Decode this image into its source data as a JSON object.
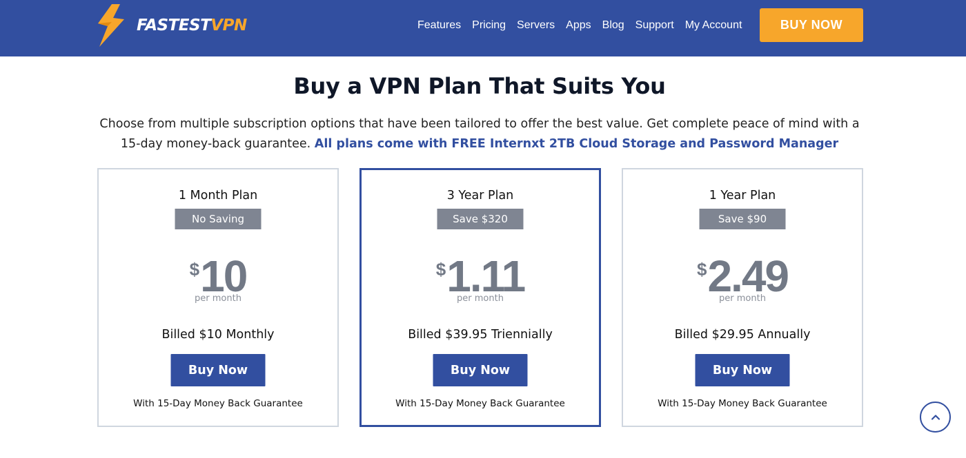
{
  "header": {
    "logo": {
      "part1": "FASTEST",
      "part2": "VPN"
    },
    "nav": [
      "Features",
      "Pricing",
      "Servers",
      "Apps",
      "Blog",
      "Support",
      "My Account"
    ],
    "cta": "BUY NOW"
  },
  "main": {
    "title": "Buy a VPN Plan That Suits You",
    "subtitle": "Choose from multiple subscription options that have been tailored to offer the best value. Get complete peace of mind with a 15-day money-back guarantee.",
    "subtitle_highlight": "All plans come with FREE Internxt 2TB Cloud Storage and Password Manager"
  },
  "plans": [
    {
      "name": "1 Month Plan",
      "badge": "No Saving",
      "currency": "$",
      "price": "10",
      "per": "per month",
      "billed": "Billed $10 Monthly",
      "button": "Buy Now",
      "guarantee": "With 15-Day Money Back Guarantee"
    },
    {
      "name": "3 Year Plan",
      "badge": "Save $320",
      "currency": "$",
      "price": "1.11",
      "per": "per month",
      "billed": "Billed $39.95 Triennially",
      "button": "Buy Now",
      "guarantee": "With 15-Day Money Back Guarantee"
    },
    {
      "name": "1 Year Plan",
      "badge": "Save $90",
      "currency": "$",
      "price": "2.49",
      "per": "per month",
      "billed": "Billed $29.95 Annually",
      "button": "Buy Now",
      "guarantee": "With 15-Day Money Back Guarantee"
    }
  ],
  "colors": {
    "brand": "#324fa0",
    "accent": "#f7a62b",
    "badge": "#7f8592"
  },
  "icons": {
    "logo": "lightning-bolt-icon",
    "scroll": "chevron-up-icon"
  }
}
